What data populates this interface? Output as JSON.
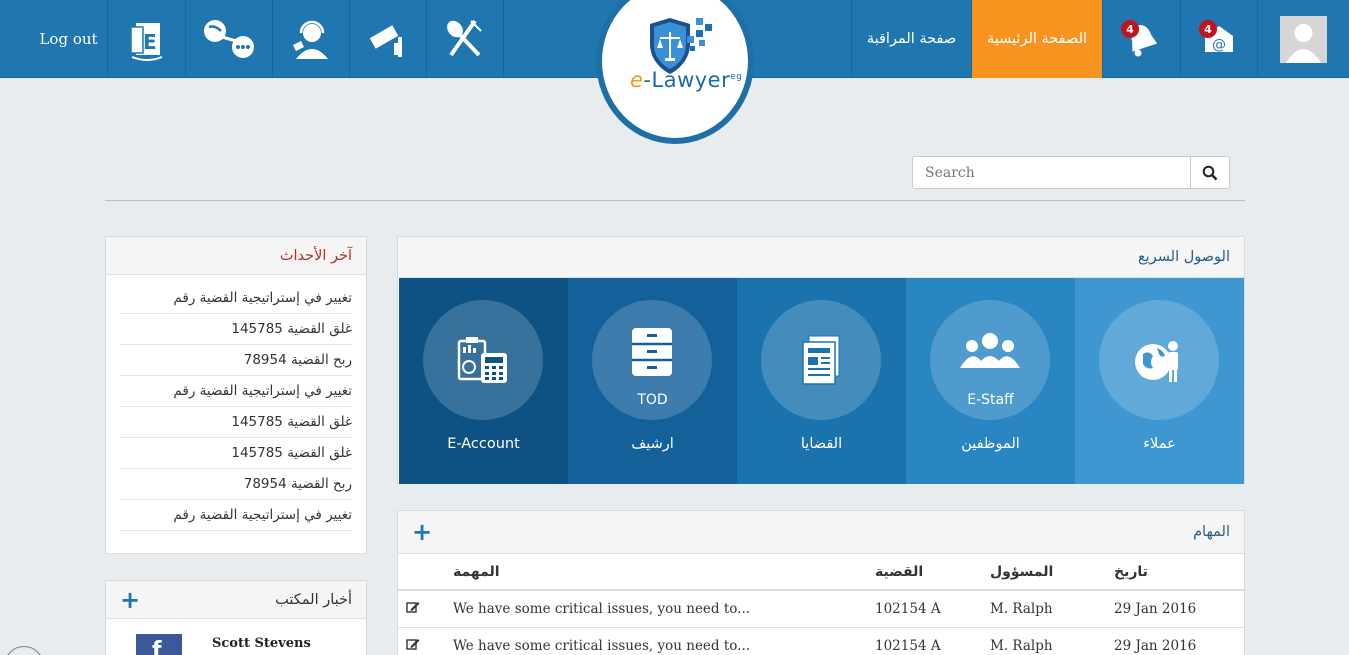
{
  "header": {
    "logout_label": "Log out",
    "monitor_label": "صفحة المراقبة",
    "home_label": "الصفحة الرئيسية",
    "notifications_count": "4",
    "messages_count": "4",
    "logo_text_e": "e",
    "logo_text_rest": "-Lawyer",
    "logo_text_suffix": "eg"
  },
  "search": {
    "placeholder": "Search"
  },
  "events": {
    "title": "آخر الأحداث",
    "items": [
      "تغيير في إستراتيجية القضية رقم",
      "غلق القضية 145785",
      "ربح القضية 78954",
      "تغيير في إستراتيجية القضية رقم",
      "غلق القضية 145785",
      "غلق القضية 145785",
      "ربح القضية 78954",
      "تغيير في إستراتيجية القضية رقم"
    ]
  },
  "news": {
    "title": "أخبار المكتب",
    "author": "Scott Stevens"
  },
  "quick_access": {
    "title": "الوصول السريع",
    "tiles": [
      {
        "label": "عملاء",
        "sub": "",
        "color": "#3e97d1",
        "icon": "client-globe-icon"
      },
      {
        "label": "الموظفين",
        "sub": "E-Staff",
        "color": "#2a85c3",
        "icon": "staff-group-icon"
      },
      {
        "label": "القضايا",
        "sub": "",
        "color": "#1b73ae",
        "icon": "case-documents-icon"
      },
      {
        "label": "ارشيف",
        "sub": "TOD",
        "color": "#13609b",
        "icon": "archive-cabinet-icon"
      },
      {
        "label": "E-Account",
        "sub": "",
        "color": "#0d5283",
        "icon": "account-calculator-icon"
      }
    ]
  },
  "tasks": {
    "title": "المهام",
    "columns": {
      "task": "المهمة",
      "case": "القضية",
      "responsible": "المسؤول",
      "date": "تاريخ"
    },
    "rows": [
      {
        "task": "We have some critical issues, you need to...",
        "case": "102154 A",
        "responsible": "M. Ralph",
        "date": "29 Jan 2016"
      },
      {
        "task": "We have some critical issues, you need to...",
        "case": "102154 A",
        "responsible": "M. Ralph",
        "date": "29 Jan 2016"
      }
    ]
  },
  "colors": {
    "topbar": "#2077b0",
    "home_active": "#f7931e",
    "events_title": "#b32d2d",
    "tasks_title": "#2a5d86",
    "badge": "#c1121f"
  }
}
